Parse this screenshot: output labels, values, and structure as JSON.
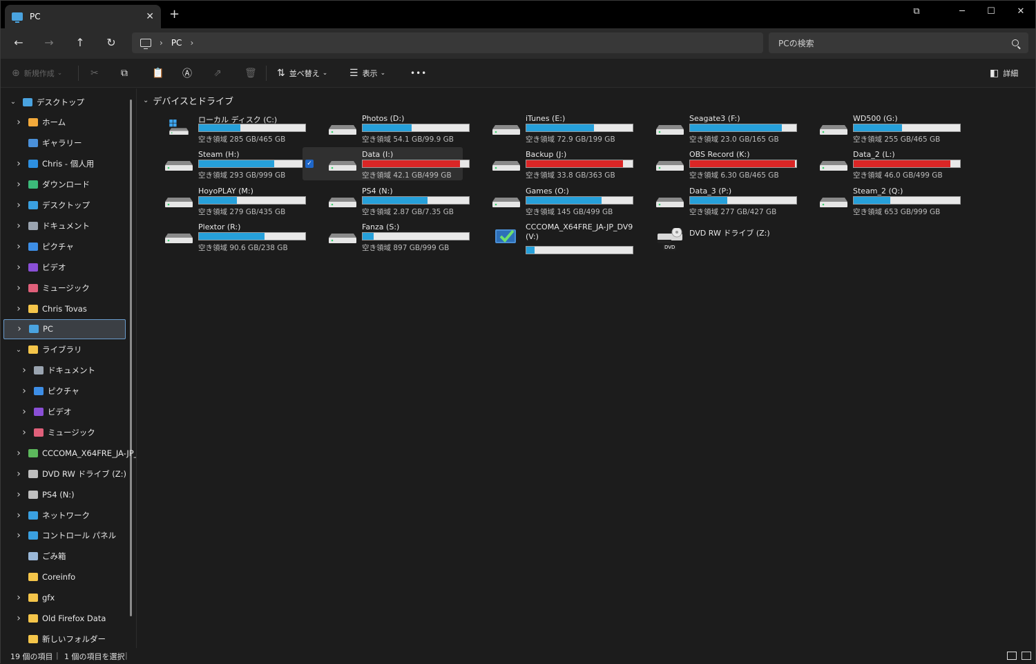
{
  "window": {
    "tab_title": "PC",
    "new_tab": "+",
    "tab_close": "✕",
    "controls": [
      "⧉",
      "─",
      "☐",
      "✕"
    ]
  },
  "address": {
    "crumbs": [
      "PC"
    ],
    "search_placeholder": "PCの検索"
  },
  "toolbar": {
    "new_label": "新規作成",
    "sort_label": "並べ替え",
    "view_label": "表示",
    "more_label": "•••",
    "details_label": "詳細"
  },
  "sidebar": {
    "items": [
      {
        "label": "デスクトップ",
        "icon": "desktop-icon",
        "color": "#4aa3df",
        "level": 0,
        "chev": "down"
      },
      {
        "label": "ホーム",
        "icon": "home-icon",
        "color": "#f2a93b",
        "level": 1,
        "chev": "right"
      },
      {
        "label": "ギャラリー",
        "icon": "gallery-icon",
        "color": "#4a90d9",
        "level": 1,
        "chev": ""
      },
      {
        "label": "Chris - 個人用",
        "icon": "cloud-icon",
        "color": "#2d8fe0",
        "level": 1,
        "chev": "right"
      },
      {
        "label": "ダウンロード",
        "icon": "download-icon",
        "color": "#3cba7a",
        "level": 1,
        "chev": "right"
      },
      {
        "label": "デスクトップ",
        "icon": "desktop-icon",
        "color": "#3aa0e0",
        "level": 1,
        "chev": "right"
      },
      {
        "label": "ドキュメント",
        "icon": "document-icon",
        "color": "#9aa4b0",
        "level": 1,
        "chev": "right"
      },
      {
        "label": "ピクチャ",
        "icon": "pictures-icon",
        "color": "#3d8ee6",
        "level": 1,
        "chev": "right"
      },
      {
        "label": "ビデオ",
        "icon": "videos-icon",
        "color": "#8a4fd6",
        "level": 1,
        "chev": "right"
      },
      {
        "label": "ミュージック",
        "icon": "music-icon",
        "color": "#e0607a",
        "level": 1,
        "chev": "right"
      },
      {
        "label": "Chris Tovas",
        "icon": "folder-icon",
        "color": "#f4c54a",
        "level": 1,
        "chev": "right"
      },
      {
        "label": "PC",
        "icon": "pc-icon",
        "color": "#4aa3df",
        "level": 1,
        "chev": "right",
        "selected": true
      },
      {
        "label": "ライブラリ",
        "icon": "folder-icon",
        "color": "#f4c54a",
        "level": 1,
        "chev": "down"
      },
      {
        "label": "ドキュメント",
        "icon": "document-icon",
        "color": "#9aa4b0",
        "level": 2,
        "chev": "right"
      },
      {
        "label": "ピクチャ",
        "icon": "pictures-icon",
        "color": "#3d8ee6",
        "level": 2,
        "chev": "right"
      },
      {
        "label": "ビデオ",
        "icon": "videos-icon",
        "color": "#8a4fd6",
        "level": 2,
        "chev": "right"
      },
      {
        "label": "ミュージック",
        "icon": "music-icon",
        "color": "#e0607a",
        "level": 2,
        "chev": "right"
      },
      {
        "label": "CCCOMA_X64FRE_JA-JP_",
        "icon": "disc-image-icon",
        "color": "#5cb85c",
        "level": 1,
        "chev": "right"
      },
      {
        "label": "DVD RW ドライブ (Z:)",
        "icon": "dvd-drive-icon",
        "color": "#bfbfbf",
        "level": 1,
        "chev": "right"
      },
      {
        "label": "PS4 (N:)",
        "icon": "drive-icon",
        "color": "#bfbfbf",
        "level": 1,
        "chev": "right"
      },
      {
        "label": "ネットワーク",
        "icon": "network-icon",
        "color": "#3aa0e0",
        "level": 1,
        "chev": "right"
      },
      {
        "label": "コントロール パネル",
        "icon": "control-panel-icon",
        "color": "#3aa0e0",
        "level": 1,
        "chev": "right"
      },
      {
        "label": "ごみ箱",
        "icon": "recycle-bin-icon",
        "color": "#9ab8d8",
        "level": 1,
        "chev": ""
      },
      {
        "label": "Coreinfo",
        "icon": "folder-icon",
        "color": "#f4c54a",
        "level": 1,
        "chev": ""
      },
      {
        "label": "gfx",
        "icon": "folder-icon",
        "color": "#f4c54a",
        "level": 1,
        "chev": "right"
      },
      {
        "label": "Old Firefox Data",
        "icon": "folder-icon",
        "color": "#f4c54a",
        "level": 1,
        "chev": "right"
      },
      {
        "label": "新しいフォルダー",
        "icon": "folder-icon",
        "color": "#f4c54a",
        "level": 1,
        "chev": ""
      }
    ]
  },
  "content": {
    "group_title": "デバイスとドライブ",
    "drives": [
      {
        "name": "ローカル ディスク (C:)",
        "free": "空き領域 285 GB/465 GB",
        "used": 0.387,
        "icon": "system-drive-icon"
      },
      {
        "name": "Photos (D:)",
        "free": "空き領域 54.1 GB/99.9 GB",
        "used": 0.458,
        "icon": "drive-icon"
      },
      {
        "name": "iTunes (E:)",
        "free": "空き領域 72.9 GB/199 GB",
        "used": 0.634,
        "icon": "drive-icon"
      },
      {
        "name": "Seagate3 (F:)",
        "free": "空き領域 23.0 GB/165 GB",
        "used": 0.861,
        "icon": "drive-icon"
      },
      {
        "name": "WD500 (G:)",
        "free": "空き領域 255 GB/465 GB",
        "used": 0.452,
        "icon": "drive-icon"
      },
      {
        "name": "Steam (H:)",
        "free": "空き領域 293 GB/999 GB",
        "used": 0.707,
        "icon": "drive-icon"
      },
      {
        "name": "Data (I:)",
        "free": "空き領域 42.1 GB/499 GB",
        "used": 0.916,
        "icon": "drive-icon",
        "selected": true,
        "check": "✓"
      },
      {
        "name": "Backup (J:)",
        "free": "空き領域 33.8 GB/363 GB",
        "used": 0.907,
        "icon": "drive-icon"
      },
      {
        "name": "OBS Record (K:)",
        "free": "空き領域 6.30 GB/465 GB",
        "used": 0.986,
        "icon": "drive-icon"
      },
      {
        "name": "Data_2 (L:)",
        "free": "空き領域 46.0 GB/499 GB",
        "used": 0.908,
        "icon": "drive-icon"
      },
      {
        "name": "HoyoPLAY (M:)",
        "free": "空き領域 279 GB/435 GB",
        "used": 0.359,
        "icon": "drive-icon"
      },
      {
        "name": "PS4 (N:)",
        "free": "空き領域 2.87 GB/7.35 GB",
        "used": 0.61,
        "icon": "drive-icon"
      },
      {
        "name": "Games (O:)",
        "free": "空き領域 145 GB/499 GB",
        "used": 0.709,
        "icon": "drive-icon"
      },
      {
        "name": "Data_3 (P:)",
        "free": "空き領域 277 GB/427 GB",
        "used": 0.351,
        "icon": "drive-icon"
      },
      {
        "name": "Steam_2 (Q:)",
        "free": "空き領域 653 GB/999 GB",
        "used": 0.346,
        "icon": "drive-icon"
      },
      {
        "name": "Plextor (R:)",
        "free": "空き領域 90.6 GB/238 GB",
        "used": 0.619,
        "icon": "drive-icon"
      },
      {
        "name": "Fanza (S:)",
        "free": "空き領域 897 GB/999 GB",
        "used": 0.102,
        "icon": "drive-icon"
      },
      {
        "name": "CCCOMA_X64FRE_JA-JP_DV9 (V:)",
        "free": "",
        "used": 0.08,
        "icon": "disc-image-icon",
        "wrap": true
      },
      {
        "name": "DVD RW ドライブ (Z:)",
        "free": "",
        "used": null,
        "icon": "dvd-drive-icon",
        "badge": "DVD"
      }
    ]
  },
  "status": {
    "count": "19 個の項目",
    "selected": "1 個の項目を選択"
  },
  "colors": {
    "bar_normal": "#26a0da",
    "bar_critical": "#da2626",
    "accent": "#1e66c8"
  }
}
